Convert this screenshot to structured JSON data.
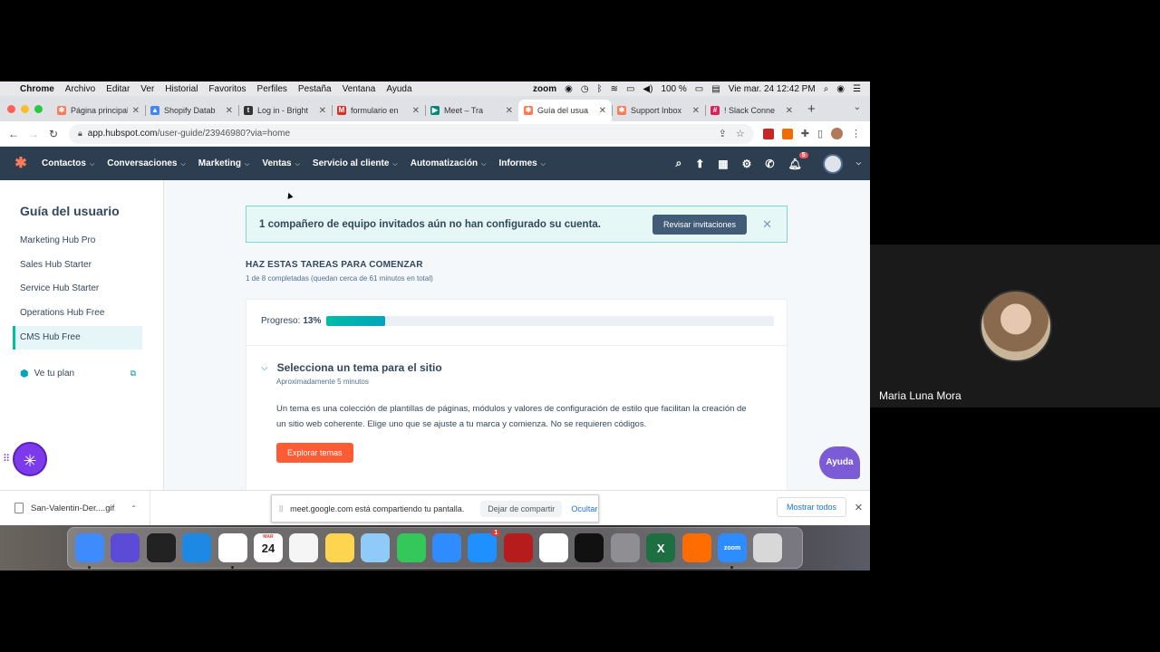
{
  "menubar": {
    "app": "Chrome",
    "items": [
      "Archivo",
      "Editar",
      "Ver",
      "Historial",
      "Favoritos",
      "Perfiles",
      "Pestaña",
      "Ventana",
      "Ayuda"
    ],
    "zoom_label": "zoom",
    "battery": "100 %",
    "datetime": "Vie mar. 24  12:42 PM"
  },
  "tabs": [
    {
      "title": "Página principal",
      "color": "#ff7a59",
      "glyph": "✱"
    },
    {
      "title": "Shopify Datab",
      "color": "#4285f4",
      "glyph": "▲"
    },
    {
      "title": "Log in - Bright",
      "color": "#333333",
      "glyph": "t"
    },
    {
      "title": "formulario en",
      "color": "#d93025",
      "glyph": "M"
    },
    {
      "title": "Meet – Tra",
      "color": "#00897b",
      "glyph": "▶"
    },
    {
      "title": "Guía del usua",
      "color": "#ff7a59",
      "glyph": "✱"
    },
    {
      "title": "Support Inbox",
      "color": "#ff7a59",
      "glyph": "✱"
    },
    {
      "title": "! Slack Conne",
      "color": "#e01e5a",
      "glyph": "#"
    }
  ],
  "address": {
    "host": "app.hubspot.com",
    "path": "/user-guide/23946980?via=home"
  },
  "hubspot_nav": {
    "items": [
      "Contactos",
      "Conversaciones",
      "Marketing",
      "Ventas",
      "Servicio al cliente",
      "Automatización",
      "Informes"
    ],
    "notification_count": "5"
  },
  "sidebar": {
    "title": "Guía del usuario",
    "items": [
      "Marketing Hub Pro",
      "Sales Hub Starter",
      "Service Hub Starter",
      "Operations Hub Free",
      "CMS Hub Free"
    ],
    "active_index": 4,
    "plan_link": "Ve tu plan"
  },
  "banner": {
    "message": "1 compañero de equipo invitados aún no han configurado su cuenta.",
    "button": "Revisar invitaciones"
  },
  "tasks": {
    "title": "HAZ ESTAS TAREAS PARA COMENZAR",
    "subtitle": "1 de 8 completadas (quedan cerca de 61 minutos en total)",
    "progress_label": "Progreso:",
    "progress_value": "13%",
    "progress_fraction": 0.13,
    "current": {
      "title": "Selecciona un tema para el sitio",
      "time": "Aproximadamente 5 minutos",
      "description": "Un tema es una colección de plantillas de páginas, módulos y valores de configuración de estilo que facilitan la creación de un sitio web coherente. Elige uno que se ajuste a tu marca y comienza. No se requieren códigos.",
      "button": "Explorar temas"
    }
  },
  "help_button": "Ayuda",
  "downloads": {
    "file": "San-Valentin-Der....gif",
    "show_all": "Mostrar todos"
  },
  "screen_share": {
    "message": "meet.google.com está compartiendo tu pantalla.",
    "stop": "Dejar de compartir",
    "hide": "Ocultar"
  },
  "dock": [
    {
      "name": "finder",
      "color": "#3d8bfd"
    },
    {
      "name": "siri",
      "color": "#5b4bd6"
    },
    {
      "name": "mission-control",
      "color": "#222222"
    },
    {
      "name": "safari",
      "color": "#1e88e5"
    },
    {
      "name": "chrome",
      "color": "#ffffff"
    },
    {
      "name": "calendar",
      "color": "#ffffff",
      "text": "24",
      "sub": "MAR"
    },
    {
      "name": "reminders",
      "color": "#f5f5f5"
    },
    {
      "name": "notes",
      "color": "#ffd54f"
    },
    {
      "name": "preview",
      "color": "#90caf9"
    },
    {
      "name": "facetime",
      "color": "#34c759"
    },
    {
      "name": "messages",
      "color": "#2f8cff"
    },
    {
      "name": "app-store",
      "color": "#1e90ff",
      "badge": "1"
    },
    {
      "name": "photo-booth",
      "color": "#b71c1c"
    },
    {
      "name": "photos",
      "color": "#ffffff"
    },
    {
      "name": "piano",
      "color": "#111111"
    },
    {
      "name": "system-preferences",
      "color": "#8e8e93"
    },
    {
      "name": "excel",
      "color": "#1d6f42",
      "text": "X"
    },
    {
      "name": "books",
      "color": "#ff6d00"
    },
    {
      "name": "zoom",
      "color": "#2d8cff",
      "text": "zoom"
    },
    {
      "name": "trash",
      "color": "#d8d8d8"
    }
  ],
  "participant": {
    "name": "Maria Luna Mora"
  }
}
